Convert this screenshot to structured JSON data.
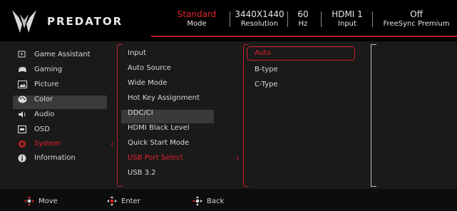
{
  "brand": {
    "name": "PREDATOR",
    "accent": "#e3202a"
  },
  "status": [
    {
      "value": "Standard",
      "key": "Mode"
    },
    {
      "value": "3440X1440",
      "key": "Resolution"
    },
    {
      "value": "60",
      "key": "Hz"
    },
    {
      "value": "HDMI 1",
      "key": "Input"
    },
    {
      "value": "Off",
      "key": "FreeSync Premium"
    }
  ],
  "menu": [
    {
      "label": "Game Assistant",
      "icon": "game-assistant-icon"
    },
    {
      "label": "Gaming",
      "icon": "gamepad-icon"
    },
    {
      "label": "Picture",
      "icon": "picture-icon"
    },
    {
      "label": "Color",
      "icon": "palette-icon"
    },
    {
      "label": "Audio",
      "icon": "speaker-icon"
    },
    {
      "label": "OSD",
      "icon": "osd-icon"
    },
    {
      "label": "System",
      "icon": "gear-icon",
      "active": true
    },
    {
      "label": "Information",
      "icon": "info-icon"
    }
  ],
  "submenu": [
    "Input",
    "Auto Source",
    "Wide Mode",
    "Hot Key Assignment",
    "DDC/CI",
    "HDMI Black Level",
    "Quick Start Mode",
    "USB Port Select",
    "USB 3.2"
  ],
  "submenu_active": "USB Port Select",
  "options": [
    "Auto",
    "B-type",
    "C-Type"
  ],
  "options_selected": "Auto",
  "footer": [
    {
      "label": "Move",
      "icon": "joystick-move-icon"
    },
    {
      "label": "Enter",
      "icon": "joystick-enter-icon"
    },
    {
      "label": "Back",
      "icon": "joystick-back-icon"
    }
  ]
}
